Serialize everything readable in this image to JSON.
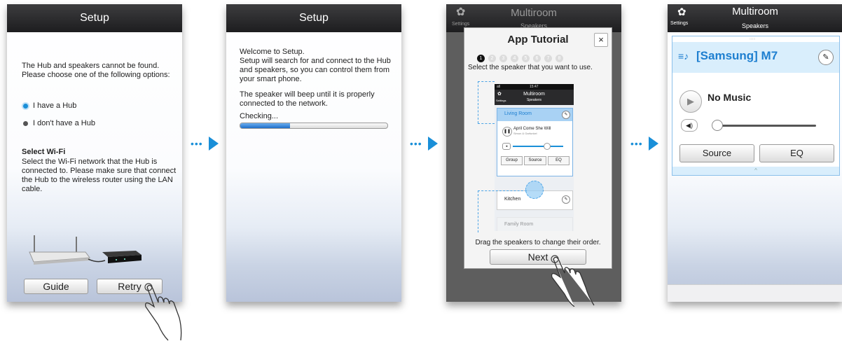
{
  "screen1": {
    "header_title": "Setup",
    "message": "The Hub and speakers cannot be found. Please choose one of the following options:",
    "option_hub": "I have a Hub",
    "option_no_hub": "I don't have a Hub",
    "wifi_title": "Select Wi-Fi",
    "wifi_text": "Select the Wi-Fi network that the Hub is connected to. Please make sure that connect the Hub to the wireless router using the LAN cable.",
    "guide_button": "Guide",
    "retry_button": "Retry"
  },
  "screen2": {
    "header_title": "Setup",
    "welcome": "Welcome to Setup.",
    "description": "Setup will search for and connect to the Hub and speakers, so you can control them from your smart phone.",
    "beep_text": "The speaker will beep until it is properly connected to the network.",
    "checking": "Checking...",
    "progress": 0.34
  },
  "screen3": {
    "bg_header_title": "Multiroom",
    "bg_header_sub": "Speakers",
    "bg_settings": "Settings",
    "dialog_title": "App Tutorial",
    "close_symbol": "×",
    "page_indicators": [
      "1",
      "2",
      "3",
      "4",
      "5",
      "6",
      "7",
      "8"
    ],
    "active_page": 0,
    "instruction": "Select the speaker that you want to use.",
    "mini": {
      "status_signal": "atl",
      "time": "15:47",
      "header_title": "Multiroom",
      "header_sub": "Speakers",
      "settings": "Settings",
      "speaker1": "Living Room",
      "song": "April Come She Will",
      "artist": "Simon & Garfunkel",
      "group_button": "Group",
      "source_button": "Source",
      "eq_button": "EQ",
      "speaker2": "Kitchen",
      "speaker3": "Family Room"
    },
    "drag_text": "Drag the speakers to change their order.",
    "next_button": "Next"
  },
  "screen4": {
    "header_title": "Multiroom",
    "header_sub": "Speakers",
    "settings_label": "Settings",
    "speaker_name": "[Samsung] M7",
    "now_playing": "No Music",
    "volume": 0.0,
    "source_button": "Source",
    "eq_button": "EQ"
  },
  "colors": {
    "accent": "#1a8fd8",
    "header": "#1d1d1f",
    "speaker_name": "#1e7fd0"
  }
}
